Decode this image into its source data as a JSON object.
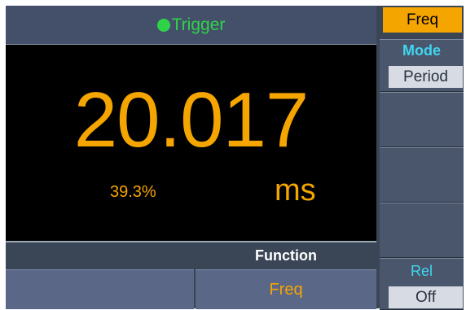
{
  "trigger": {
    "label": "Trigger",
    "indicator_color": "#2ed34a"
  },
  "measurement": {
    "value": "20.017",
    "unit": "ms",
    "percent": "39.3%"
  },
  "function_bar": {
    "header": "Function",
    "left_key": "",
    "right_key": "Freq"
  },
  "softkeys": {
    "freq": "Freq",
    "mode_label": "Mode",
    "mode_value": "Period",
    "rel_label": "Rel",
    "rel_value": "Off"
  },
  "colors": {
    "accent": "#f5a500",
    "label_cyan": "#40d6f0",
    "panel": "#3a4656"
  }
}
